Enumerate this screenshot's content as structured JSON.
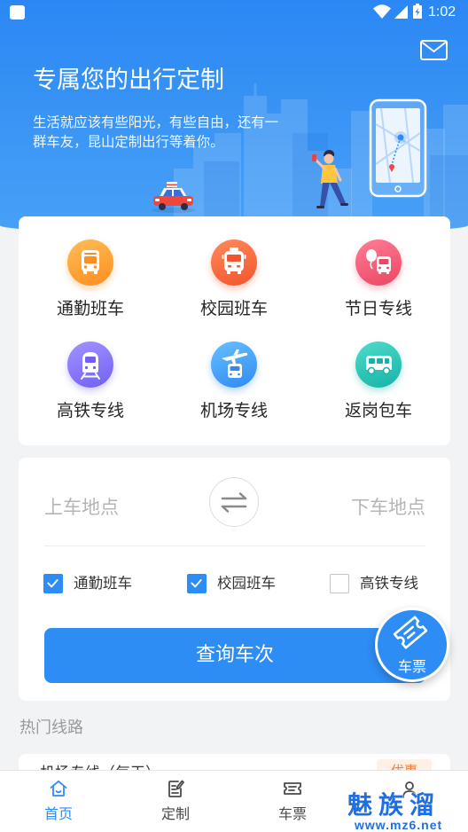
{
  "status_bar": {
    "time": "1:02",
    "icons": [
      "notification-icon",
      "wifi-icon",
      "signal-icon",
      "battery-icon"
    ]
  },
  "header": {
    "title": "专属您的出行定制",
    "subtitle": "生活就应该有些阳光，有些自由，还有一群车友，昆山定制出行等着你。",
    "action_icon": "mail-icon"
  },
  "services": [
    {
      "label": "通勤班车",
      "icon": "commuter-bus-icon",
      "colors": [
        "#ffbe55",
        "#ff8d1f"
      ]
    },
    {
      "label": "校园班车",
      "icon": "school-bus-icon",
      "colors": [
        "#ff8a5a",
        "#f2542d"
      ]
    },
    {
      "label": "节日专线",
      "icon": "holiday-bus-icon",
      "colors": [
        "#ff7d95",
        "#eb4662"
      ]
    },
    {
      "label": "高铁专线",
      "icon": "high-speed-rail-icon",
      "colors": [
        "#a393ff",
        "#7060f5"
      ]
    },
    {
      "label": "机场专线",
      "icon": "airport-bus-icon",
      "colors": [
        "#67c0ff",
        "#2f8af5"
      ]
    },
    {
      "label": "返岗包车",
      "icon": "charter-bus-icon",
      "colors": [
        "#4fdcc9",
        "#15b3a7"
      ]
    }
  ],
  "search": {
    "from_placeholder": "上车地点",
    "to_placeholder": "下车地点",
    "swap_icon": "swap-icon",
    "options": [
      {
        "label": "通勤班车",
        "checked": true
      },
      {
        "label": "校园班车",
        "checked": true
      },
      {
        "label": "高铁专线",
        "checked": false
      }
    ],
    "submit_label": "查询车次"
  },
  "ticket_fab": {
    "label": "车票",
    "icon": "ticket-icon"
  },
  "hot_routes": {
    "heading": "热门线路",
    "items": [
      {
        "name": "机场专线（每天）",
        "badge": "优惠"
      }
    ]
  },
  "tabs": [
    {
      "label": "首页",
      "icon": "home-icon",
      "active": true
    },
    {
      "label": "定制",
      "icon": "customize-icon",
      "active": false
    },
    {
      "label": "车票",
      "icon": "ticket-icon",
      "active": false
    },
    {
      "icon": "profile-icon",
      "active": false
    }
  ],
  "watermark": {
    "name": "魅族溜",
    "url": "www.mz6.net"
  },
  "colors": {
    "primary": "#2e8cf5",
    "header_top": "#2b87f3",
    "header_bottom": "#48a1f7",
    "page_bg": "#f2f3f5",
    "badge": "#ff7a30"
  }
}
